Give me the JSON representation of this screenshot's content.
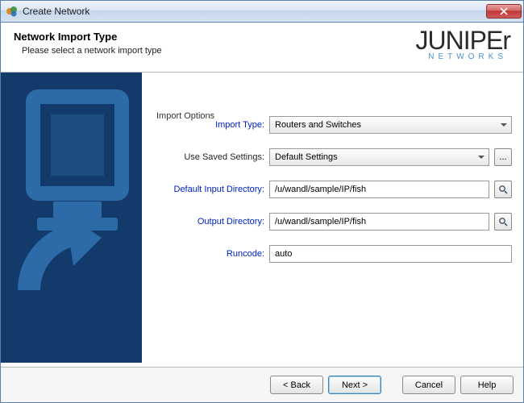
{
  "window": {
    "title": "Create Network"
  },
  "header": {
    "title": "Network Import Type",
    "subtitle": "Please select a network import type",
    "brand_main": "JUNIPEr",
    "brand_sub": "NETWORKS"
  },
  "form": {
    "section_label": "Import Options",
    "labels": {
      "import_type": "Import Type:",
      "saved_settings": "Use Saved Settings:",
      "default_input_dir": "Default Input Directory:",
      "output_dir": "Output Directory:",
      "runcode": "Runcode:"
    },
    "values": {
      "import_type": "Routers and Switches",
      "saved_settings": "Default Settings",
      "default_input_dir": "/u/wandl/sample/IP/fish",
      "output_dir": "/u/wandl/sample/IP/fish",
      "runcode": "auto"
    },
    "ellipsis": "..."
  },
  "footer": {
    "back": "< Back",
    "next": "Next >",
    "cancel": "Cancel",
    "help": "Help"
  }
}
